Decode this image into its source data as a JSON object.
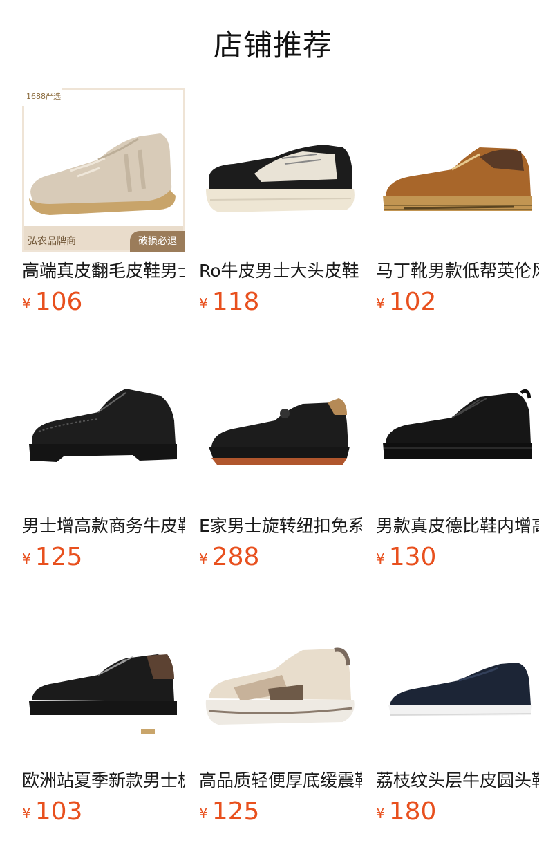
{
  "page": {
    "title": "店铺推荐"
  },
  "products": [
    {
      "name": "高端真皮翻毛皮鞋男士",
      "currency": "¥",
      "price": "106",
      "badge": "1688严选",
      "brand": "弘农品牌商",
      "guarantee": "破损必退",
      "icon": "suede-sneaker-image"
    },
    {
      "name": "Ro牛皮男士大头皮鞋",
      "currency": "¥",
      "price": "118",
      "icon": "thick-sole-sneaker-image"
    },
    {
      "name": "马丁靴男款低帮英伦风",
      "currency": "¥",
      "price": "102",
      "icon": "work-boot-image"
    },
    {
      "name": "男士增高款商务牛皮鞋",
      "currency": "¥",
      "price": "125",
      "icon": "brogue-shoe-image"
    },
    {
      "name": "E家男士旋转纽扣免系带",
      "currency": "¥",
      "price": "288",
      "icon": "leather-sneaker-image"
    },
    {
      "name": "男款真皮德比鞋内增高",
      "currency": "¥",
      "price": "130",
      "icon": "derby-shoe-image"
    },
    {
      "name": "欧洲站夏季新款男士板鞋",
      "currency": "¥",
      "price": "103",
      "icon": "embossed-sneaker-image"
    },
    {
      "name": "高品质轻便厚底缓震鞋",
      "currency": "¥",
      "price": "125",
      "icon": "chunky-sneaker-image"
    },
    {
      "name": "荔枝纹头层牛皮圆头鞋",
      "currency": "¥",
      "price": "180",
      "icon": "slip-on-shoe-image"
    }
  ]
}
